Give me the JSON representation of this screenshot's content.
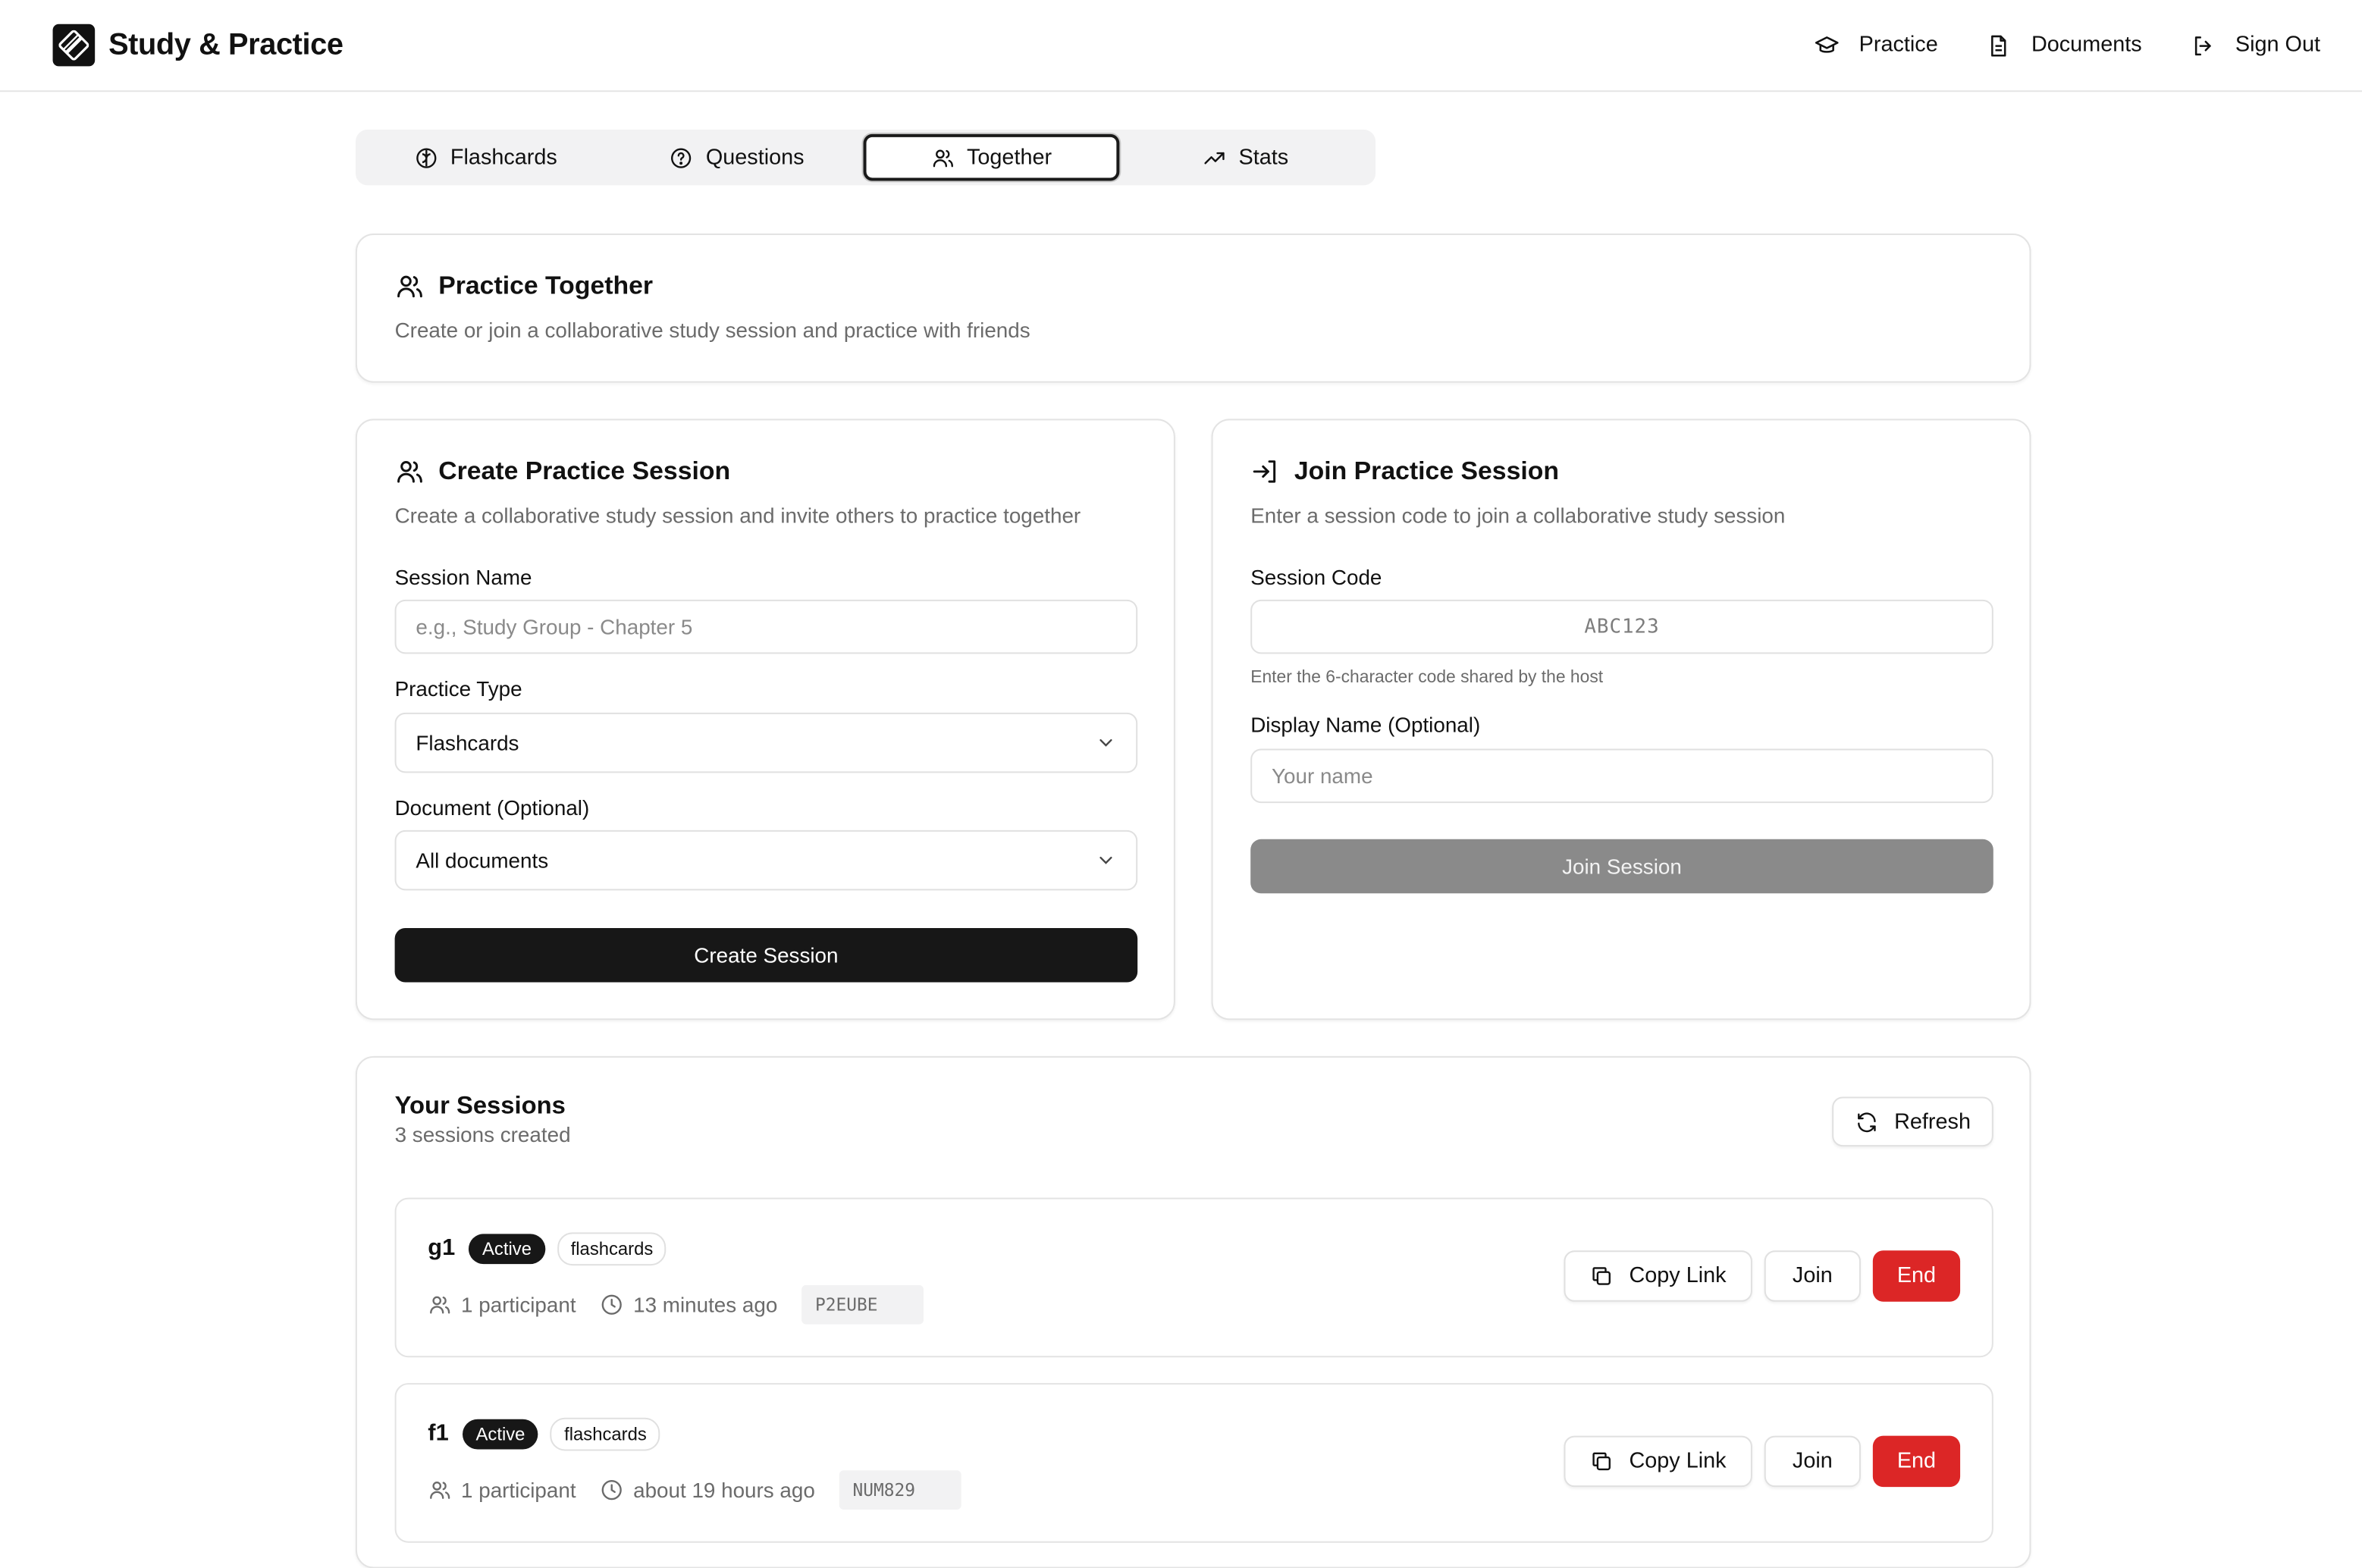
{
  "app": {
    "title": "Study & Practice"
  },
  "topnav": [
    {
      "label": "Practice",
      "icon": "graduation-cap-icon"
    },
    {
      "label": "Documents",
      "icon": "file-text-icon"
    },
    {
      "label": "Sign Out",
      "icon": "log-out-icon"
    }
  ],
  "tabs": [
    {
      "label": "Flashcards",
      "icon": "brain-icon",
      "active": false
    },
    {
      "label": "Questions",
      "icon": "help-circle-icon",
      "active": false
    },
    {
      "label": "Together",
      "icon": "users-icon",
      "active": true
    },
    {
      "label": "Stats",
      "icon": "trending-up-icon",
      "active": false
    }
  ],
  "intro": {
    "title": "Practice Together",
    "description": "Create or join a collaborative study session and practice with friends"
  },
  "create": {
    "title": "Create Practice Session",
    "description": "Create a collaborative study session and invite others to practice together",
    "session_name_label": "Session Name",
    "session_name_placeholder": "e.g., Study Group - Chapter 5",
    "practice_type_label": "Practice Type",
    "practice_type_value": "Flashcards",
    "document_label": "Document (Optional)",
    "document_value": "All documents",
    "submit_label": "Create Session"
  },
  "join": {
    "title": "Join Practice Session",
    "description": "Enter a session code to join a collaborative study session",
    "code_label": "Session Code",
    "code_placeholder": "ABC123",
    "code_hint": "Enter the 6-character code shared by the host",
    "display_name_label": "Display Name (Optional)",
    "display_name_placeholder": "Your name",
    "submit_label": "Join Session"
  },
  "sessions": {
    "title": "Your Sessions",
    "subtitle": "3 sessions created",
    "refresh_label": "Refresh",
    "items": [
      {
        "name": "g1",
        "status": "Active",
        "type": "flashcards",
        "participants": "1 participant",
        "time": "13 minutes ago",
        "code": "P2EUBE",
        "copy_label": "Copy Link",
        "join_label": "Join",
        "end_label": "End"
      },
      {
        "name": "f1",
        "status": "Active",
        "type": "flashcards",
        "participants": "1 participant",
        "time": "about 19 hours ago",
        "code": "NUM829",
        "copy_label": "Copy Link",
        "join_label": "Join",
        "end_label": "End"
      }
    ]
  },
  "colors": {
    "primary": "#171717",
    "danger": "#dc2626",
    "muted": "#6b6b6b",
    "disabled": "#8a8a8a",
    "border": "#e3e3e3"
  }
}
